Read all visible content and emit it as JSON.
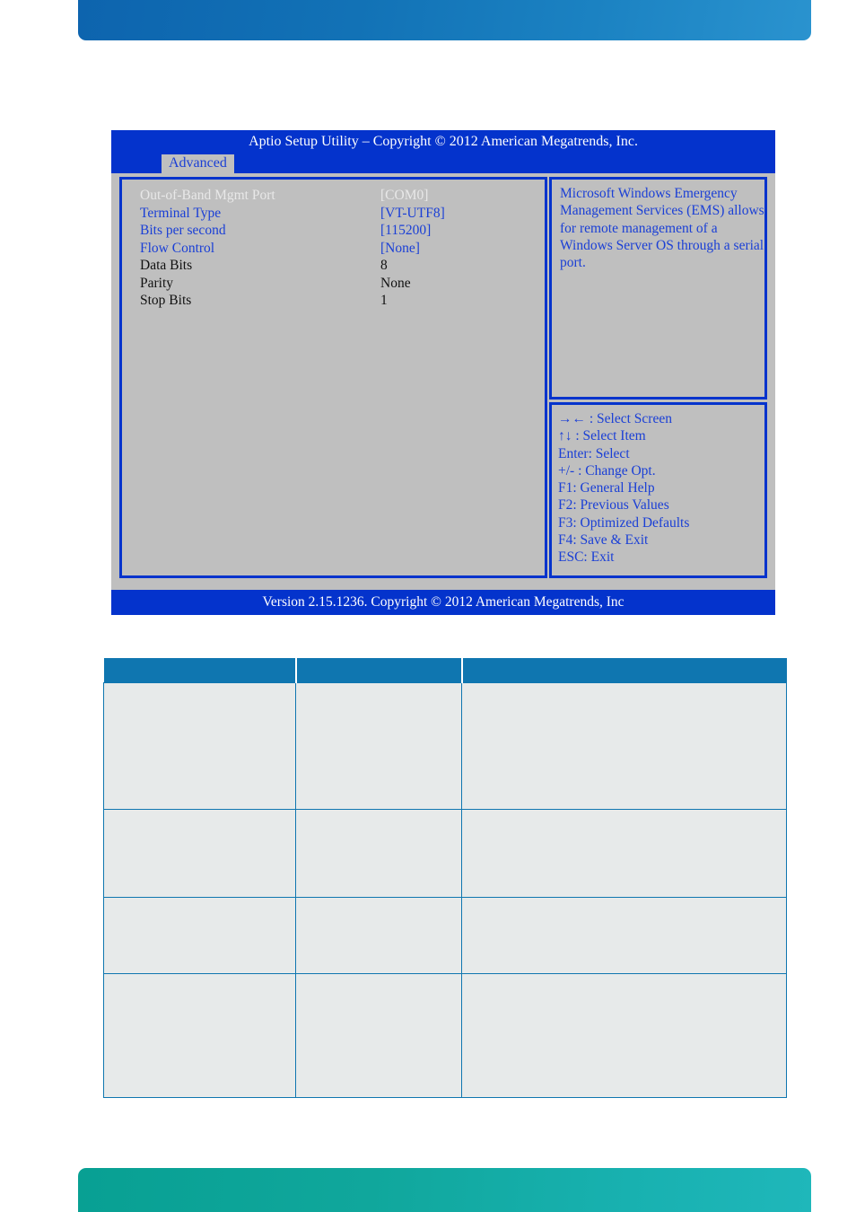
{
  "banners": {
    "top_color": "#1272b6",
    "bottom_color": "#10a79c"
  },
  "bios": {
    "title": "Aptio Setup Utility  –  Copyright © 2012 American Megatrends, Inc.",
    "active_tab": "Advanced",
    "footer": "Version 2.15.1236. Copyright © 2012 American Megatrends, Inc",
    "colors": {
      "screen_background": "#bfbfbf",
      "chrome_blue": "#0433cc",
      "option_text": "#1a3fd6",
      "selected_text": "#e8e8e8",
      "readonly_text": "#111111"
    },
    "items": [
      {
        "label": "Out-of-Band Mgmt Port",
        "value": "[COM0]",
        "state": "selected"
      },
      {
        "label": "Terminal Type",
        "value": "[VT-UTF8]",
        "state": "option"
      },
      {
        "label": "Bits per second",
        "value": "[115200]",
        "state": "option"
      },
      {
        "label": "Flow Control",
        "value": "[None]",
        "state": "option"
      },
      {
        "label": "Data Bits",
        "value": "8",
        "state": "readonly"
      },
      {
        "label": "Parity",
        "value": "None",
        "state": "readonly"
      },
      {
        "label": "Stop Bits",
        "value": "1",
        "state": "readonly"
      }
    ],
    "help_text": "Microsoft Windows Emergency Management Services (EMS) allows for remote management of a Windows Server OS through a serial port.",
    "keys": [
      "→← : Select Screen",
      "↑↓ : Select Item",
      "Enter: Select",
      "+/- : Change Opt.",
      "F1: General Help",
      "F2: Previous Values",
      "F3: Optimized Defaults",
      "F4: Save & Exit",
      "ESC: Exit"
    ]
  },
  "table": {
    "header_color": "#0f76b0",
    "cell_color": "#e7eaea",
    "headers": [
      "",
      "",
      ""
    ],
    "rows": [
      [
        "",
        "",
        ""
      ],
      [
        "",
        "",
        ""
      ],
      [
        "",
        "",
        ""
      ],
      [
        "",
        "",
        ""
      ]
    ]
  }
}
